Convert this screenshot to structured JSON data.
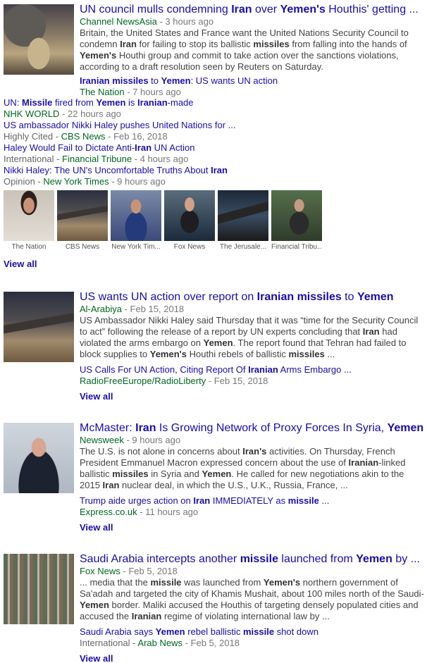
{
  "story1": {
    "title_parts": [
      "UN council mulls condemning ",
      "Iran",
      " over ",
      "Yemen's",
      " Houthis' getting ..."
    ],
    "source": "Channel NewsAsia",
    "time": "3 hours ago",
    "snippet_parts": [
      "Britain, the United States and France want the United Nations Security Council to condemn ",
      "Iran",
      " for failing to stop its ballistic ",
      "missiles",
      " from falling into the hands of ",
      "Yemen's",
      " Houthi group and commit to take action over the sanctions violations, according to a draft resolution seen by Reuters on Saturday."
    ],
    "related": [
      {
        "title_parts": [
          "Iranian missiles",
          " to ",
          "Yemen",
          ": US wants UN action"
        ],
        "pre": "",
        "source": "The Nation",
        "time": "7 hours ago"
      },
      {
        "title_parts": [
          "UN: ",
          "Missile",
          " fired from ",
          "Yemen",
          " is ",
          "Iranian",
          "-made"
        ],
        "pre": "",
        "source": "NHK WORLD",
        "time": "22 hours ago"
      },
      {
        "title_parts": [
          "US ambassador Nikki Haley pushes United Nations for ..."
        ],
        "pre": "Highly Cited",
        "source": "CBS News",
        "time": "Feb 16, 2018"
      },
      {
        "title_parts": [
          "Haley Would Fail to Dictate Anti-",
          "Iran",
          " UN Action"
        ],
        "pre": "International",
        "source": "Financial Tribune",
        "time": "4 hours ago"
      },
      {
        "title_parts": [
          "Nikki Haley: The UN's Uncomfortable Truths About ",
          "Iran"
        ],
        "pre": "Opinion",
        "source": "New York Times",
        "time": "9 hours ago"
      }
    ],
    "images": [
      {
        "caption": "The Nation",
        "icon": "haley-praying-photo"
      },
      {
        "caption": "CBS News",
        "icon": "missile-debris-photo"
      },
      {
        "caption": "New York Tim...",
        "icon": "haley-speaking-photo"
      },
      {
        "caption": "Fox News",
        "icon": "haley-podium-photo"
      },
      {
        "caption": "The Jerusale...",
        "icon": "missile-display-photo"
      },
      {
        "caption": "Financial Tribu...",
        "icon": "official-speaking-photo"
      }
    ],
    "view_all": "View all"
  },
  "story2": {
    "title_parts": [
      "US wants UN action over report on ",
      "Iranian missiles",
      " to ",
      "Yemen"
    ],
    "source": "Al-Arabiya",
    "time": "Feb 15, 2018",
    "snippet_parts": [
      "US Ambassador Nikki Haley said Thursday that it was “time for the Security Council to act” following the release of a report by UN experts concluding that ",
      "Iran",
      " had violated the arms embargo on ",
      "Yemen",
      ". The report found that Tehran had failed to block supplies to ",
      "Yemen's",
      " Houthi rebels of ballistic ",
      "missiles",
      " ..."
    ],
    "related": [
      {
        "title_parts": [
          "US Calls For UN Action, Citing Report Of ",
          "Iranian",
          " Arms Embargo ..."
        ],
        "pre": "",
        "source": "RadioFreeEurope/RadioLiberty",
        "time": "Feb 15, 2018"
      }
    ],
    "view_all": "View all"
  },
  "story3": {
    "title_parts": [
      "McMaster: ",
      "Iran",
      " Is Growing Network of Proxy Forces In Syria, ",
      "Yemen",
      " ..."
    ],
    "source": "Newsweek",
    "time": "9 hours ago",
    "snippet_parts": [
      "The U.S. is not alone in concerns about ",
      "Iran's",
      " activities. On Thursday, French President Emmanuel Macron expressed concern about the use of ",
      "Iranian",
      "-linked ballistic ",
      "missiles",
      " in Syria and ",
      "Yemen",
      ". He called for new negotiations akin to the 2015 ",
      "Iran",
      " nuclear deal, in which the U.S., U.K., Russia, France, ..."
    ],
    "related": [
      {
        "title_parts": [
          "Trump aide urges action on ",
          "Iran",
          " IMMEDIATELY as ",
          "missile",
          " ..."
        ],
        "pre": "",
        "source": "Express.co.uk",
        "time": "11 hours ago"
      }
    ],
    "view_all": "View all"
  },
  "story4": {
    "title_parts": [
      "Saudi Arabia intercepts another ",
      "missile",
      " launched from ",
      "Yemen",
      " by ..."
    ],
    "source": "Fox News",
    "time": "Feb 5, 2018",
    "snippet_parts": [
      "... media that the ",
      "missile",
      " was launched from ",
      "Yemen's",
      " northern government of Sa'adah and targeted the city of Khamis Mushait, about 100 miles north of the Saudi-",
      "Yemen",
      " border. Maliki accused the Houthis of targeting densely populated cities and accused the ",
      "Iranian",
      " regime of violating international law by ..."
    ],
    "related": [
      {
        "title_parts": [
          "Saudi Arabia says ",
          "Yemen",
          " rebel ballistic ",
          "missile",
          " shot down"
        ],
        "pre": "International",
        "source": "Arab News",
        "time": "Feb 5, 2018"
      }
    ],
    "view_all": "View all"
  }
}
